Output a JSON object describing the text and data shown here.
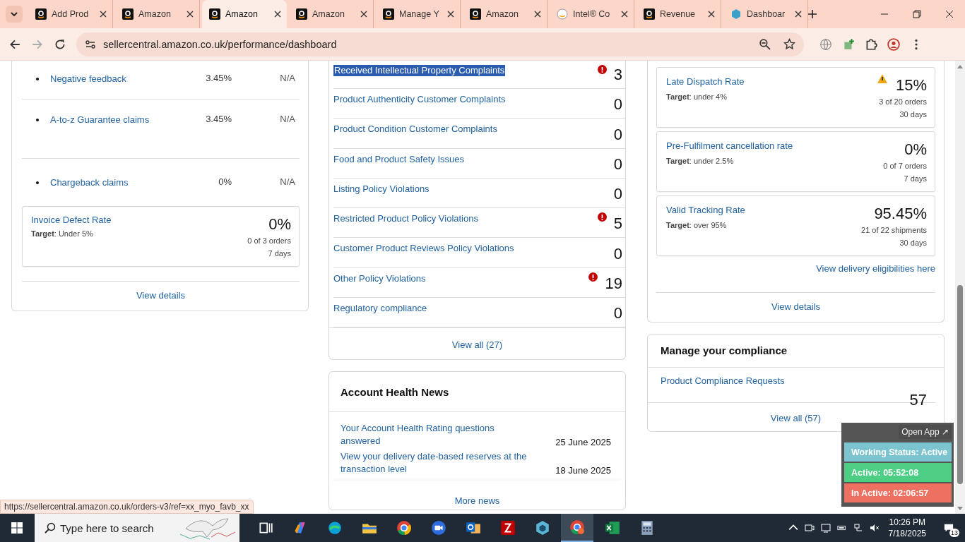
{
  "tabs": [
    {
      "title": "Add Prod",
      "kind": "amazon",
      "selected": false
    },
    {
      "title": "Amazon",
      "kind": "amazon",
      "selected": false
    },
    {
      "title": "Amazon",
      "kind": "amazon",
      "selected": true
    },
    {
      "title": "Amazon",
      "kind": "amazon",
      "selected": false
    },
    {
      "title": "Manage Y",
      "kind": "amazon",
      "selected": false
    },
    {
      "title": "Amazon",
      "kind": "amazon",
      "selected": false
    },
    {
      "title": "Intel® Co",
      "kind": "intel",
      "selected": false
    },
    {
      "title": "Revenue",
      "kind": "amazon",
      "selected": false
    },
    {
      "title": "Dashboar",
      "kind": "hex",
      "selected": false
    }
  ],
  "address_bar": {
    "url": "sellercentral.amazon.co.uk/performance/dashboard"
  },
  "customer_metrics": {
    "rows": [
      {
        "name": "Negative feedback",
        "value": "3.45%",
        "target": "N/A"
      },
      {
        "name": "A-to-z Guarantee claims",
        "value": "3.45%",
        "target": "N/A"
      },
      {
        "name": "Chargeback claims",
        "value": "0%",
        "target": "N/A"
      }
    ],
    "invoice": {
      "title": "Invoice Defect Rate",
      "target_label": "Target",
      "target": ": Under 5%",
      "value": "0%",
      "detail": "0 of 3 orders",
      "period": "7 days"
    },
    "link": "View details"
  },
  "policy_compliance": {
    "rows": [
      {
        "name": "Received Intellectual Property Complaints",
        "count": "3",
        "alert": true,
        "highlighted": true
      },
      {
        "name": "Product Authenticity Customer Complaints",
        "count": "0",
        "alert": false,
        "highlighted": false
      },
      {
        "name": "Product Condition Customer Complaints",
        "count": "0",
        "alert": false,
        "highlighted": false
      },
      {
        "name": "Food and Product Safety Issues",
        "count": "0",
        "alert": false,
        "highlighted": false
      },
      {
        "name": "Listing Policy Violations",
        "count": "0",
        "alert": false,
        "highlighted": false
      },
      {
        "name": "Restricted Product Policy Violations",
        "count": "5",
        "alert": true,
        "highlighted": false
      },
      {
        "name": "Customer Product Reviews Policy Violations",
        "count": "0",
        "alert": false,
        "highlighted": false
      },
      {
        "name": "Other Policy Violations",
        "count": "19",
        "alert": true,
        "highlighted": false
      },
      {
        "name": "Regulatory compliance",
        "count": "0",
        "alert": false,
        "highlighted": false
      }
    ],
    "link": "View all (27)"
  },
  "account_health_news": {
    "title": "Account Health News",
    "items": [
      {
        "text": "Your Account Health Rating questions answered",
        "date": "25 June 2025"
      },
      {
        "text": "View your delivery date-based reserves at the transaction level",
        "date": "18 June 2025"
      }
    ],
    "link": "More news"
  },
  "shipping_performance": {
    "metrics": [
      {
        "title": "Late Dispatch Rate",
        "target_label": "Target",
        "target": ": under 4%",
        "value": "15%",
        "warning": true,
        "detail": "3 of 20 orders",
        "period": "30 days"
      },
      {
        "title": "Pre-Fulfilment cancellation rate",
        "target_label": "Target",
        "target": ": under 2.5%",
        "value": "0%",
        "warning": false,
        "detail": "0 of 7 orders",
        "period": "7 days"
      },
      {
        "title": "Valid Tracking Rate",
        "target_label": "Target",
        "target": ": over 95%",
        "value": "95.45%",
        "warning": false,
        "detail": "21 of 22 shipments",
        "period": "30 days"
      }
    ],
    "eligibility_link": "View delivery eligibilities here",
    "link": "View details"
  },
  "manage_compliance": {
    "title": "Manage your compliance",
    "row": {
      "name": "Product Compliance Requests",
      "count": "57"
    },
    "link": "View all (57)"
  },
  "status_widget": {
    "open_app": "Open App ↗",
    "rows": [
      {
        "text": "Working Status: Active",
        "color": "#7cc4cf"
      },
      {
        "text": "Active: 05:52:08",
        "color": "#4ccf84"
      },
      {
        "text": "In Active: 02:06:57",
        "color": "#ee7061"
      }
    ]
  },
  "status_url": "https://sellercentral.amazon.co.uk/orders-v3/ref=xx_myo_favb_xx",
  "taskbar": {
    "search_placeholder": "Type here to search",
    "time": "10:26 PM",
    "date": "7/18/2025",
    "notifications": "13"
  }
}
